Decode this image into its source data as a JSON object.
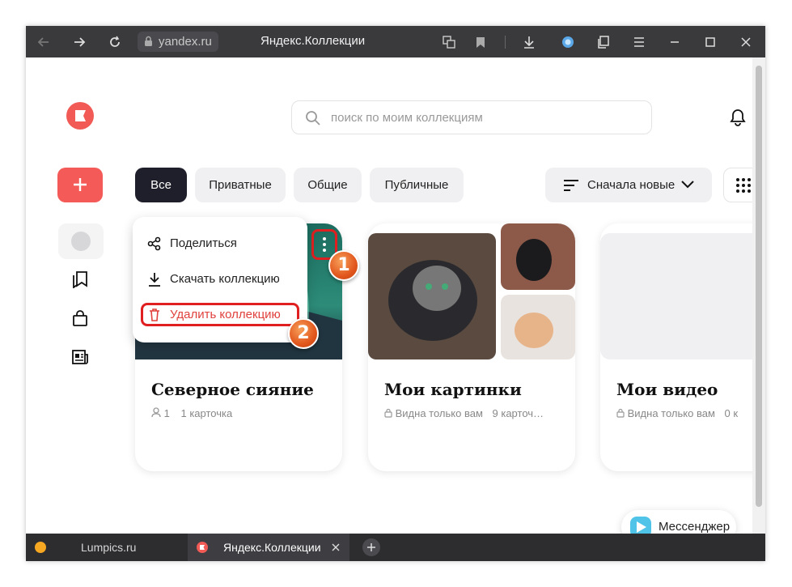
{
  "browser": {
    "address": "yandex.ru",
    "window_title": "Яндекс.Коллекции",
    "icons": [
      "back-icon",
      "forward-icon",
      "reload-icon",
      "lock-icon",
      "translate-icon",
      "bookmark-icon",
      "download-icon",
      "alice-icon",
      "collections-icon",
      "menu-icon",
      "minimize-icon",
      "maximize-icon",
      "close-icon"
    ]
  },
  "header": {
    "search_placeholder": "поиск по моим коллекциям"
  },
  "filters": [
    {
      "label": "Все",
      "active": true
    },
    {
      "label": "Приватные",
      "active": false
    },
    {
      "label": "Общие",
      "active": false
    },
    {
      "label": "Публичные",
      "active": false
    }
  ],
  "sort": {
    "label": "Сначала новые"
  },
  "context_menu": {
    "share": "Поделиться",
    "download": "Скачать коллекцию",
    "delete": "Удалить коллекцию"
  },
  "annotations": {
    "step1": "1",
    "step2": "2"
  },
  "cards": [
    {
      "title": "Северное сияние",
      "followers": "1",
      "count": "1 карточка"
    },
    {
      "title": "Мои картинки",
      "visibility": "Видна только вам",
      "count": "9 карточ…"
    },
    {
      "title": "Мои видео",
      "visibility": "Видна только вам",
      "count": "0 к"
    }
  ],
  "messenger": {
    "label": "Мессенджер"
  },
  "tabs": [
    {
      "label": "Lumpics.ru"
    },
    {
      "label": "Яндекс.Коллекции"
    }
  ],
  "colors": {
    "accent": "#f45b58",
    "dark": "#1f1f2b",
    "highlight": "#e02020",
    "danger": "#e0413d"
  }
}
